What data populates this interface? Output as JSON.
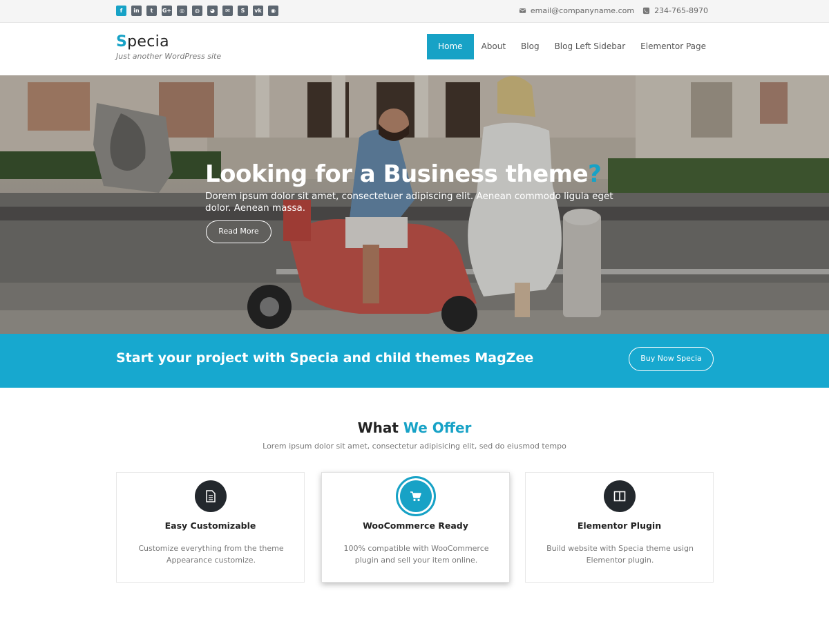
{
  "topbar": {
    "social_icons": [
      {
        "name": "facebook-icon",
        "glyph": "f"
      },
      {
        "name": "linkedin-icon",
        "glyph": "in"
      },
      {
        "name": "twitter-icon",
        "glyph": "t"
      },
      {
        "name": "google-plus-icon",
        "glyph": "G+"
      },
      {
        "name": "instagram-icon",
        "glyph": "◎"
      },
      {
        "name": "dribbble-icon",
        "glyph": "◍"
      },
      {
        "name": "github-icon",
        "glyph": "◕"
      },
      {
        "name": "email-social-icon",
        "glyph": "✉"
      },
      {
        "name": "skype-icon",
        "glyph": "S"
      },
      {
        "name": "vk-icon",
        "glyph": "vk"
      },
      {
        "name": "foursquare-icon",
        "glyph": "◉"
      }
    ],
    "email": "email@companyname.com",
    "phone": "234-765-8970"
  },
  "header": {
    "logo_first": "S",
    "logo_rest": "pecia",
    "tagline": "Just another WordPress site",
    "nav": [
      "Home",
      "About",
      "Blog",
      "Blog Left Sidebar",
      "Elementor Page"
    ]
  },
  "hero": {
    "title": "Looking for a Business theme",
    "title_mark": "?",
    "text": "Dorem ipsum dolor sit amet, consectetuer adipiscing elit. Aenean commodo ligula eget dolor. Aenean massa.",
    "button": "Read More"
  },
  "cta": {
    "text": "Start your project with Specia and child themes MagZee",
    "button": "Buy Now Specia"
  },
  "offer": {
    "title_a": "What",
    "title_b": "We Offer",
    "subtitle": "Lorem ipsum dolor sit amet, consectetur adipisicing elit, sed do eiusmod tempo",
    "cards": [
      {
        "title": "Easy Customizable",
        "text": "Customize everything from the theme Appearance customize.",
        "icon": "document-icon"
      },
      {
        "title": "WooCommerce Ready",
        "text": "100% compatible with WooCommerce plugin and sell your item online.",
        "icon": "cart-icon"
      },
      {
        "title": "Elementor Plugin",
        "text": "Build website with Specia theme usign Elementor plugin.",
        "icon": "columns-icon"
      }
    ]
  },
  "colors": {
    "accent": "#17a2c6",
    "cta_background": "#17a8cf",
    "dark_icon": "#23282d"
  }
}
